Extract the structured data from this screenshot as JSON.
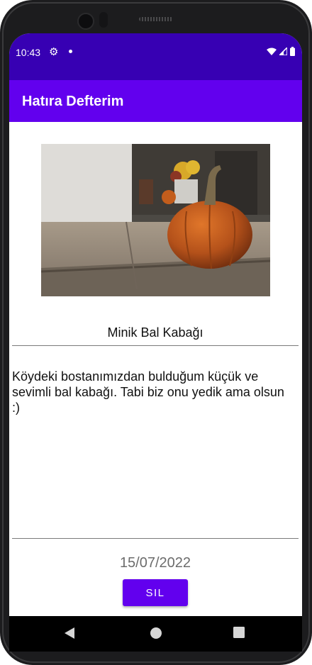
{
  "statusbar": {
    "time": "10:43",
    "icons": [
      "settings-icon",
      "notification-dot-icon",
      "wifi-icon",
      "signal-icon",
      "battery-icon"
    ]
  },
  "appbar": {
    "title": "Hatıra Defterim"
  },
  "memory": {
    "image": "pumpkin-photo",
    "name": "Minik Bal Kabağı",
    "description": "Köydeki bostanımızdan bulduğum küçük ve sevimli bal kabağı. Tabi biz onu yedik ama olsun :)",
    "date": "15/07/2022"
  },
  "actions": {
    "delete_label": "SIL"
  },
  "navbar": {
    "icons": [
      "back-icon",
      "home-icon",
      "recents-icon"
    ]
  },
  "colors": {
    "statusbar": "#3700b3",
    "primary": "#6200ee",
    "navbar": "#000000"
  }
}
